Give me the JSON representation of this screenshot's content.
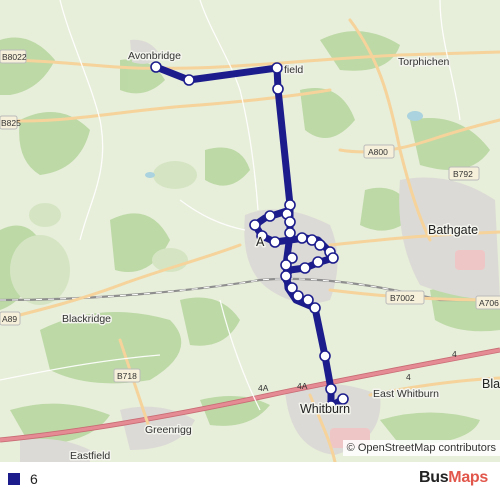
{
  "map": {
    "place_labels": [
      "Avonbridge",
      "field",
      "Torphichen",
      "Bathgate",
      "Blackridge",
      "Greenrigg",
      "Eastfield",
      "East Whitburn",
      "Whitburn",
      "Bla",
      "A"
    ],
    "road_labels": [
      "B8022",
      "B825",
      "A800",
      "B792",
      "B7002",
      "A706",
      "A89",
      "B718",
      "4A",
      "4A",
      "4",
      "4"
    ],
    "attribution_symbol": "©",
    "attribution_text": "OpenStreetMap contributors"
  },
  "legend": {
    "route_name": "6",
    "route_color": "#1c1c8c",
    "logo_part1": "Bus",
    "logo_part2": "Maps"
  },
  "colors": {
    "land": "#e7eed9",
    "woodland": "#b8d7a1",
    "urban": "#dcdad6",
    "motorway": "#e48b93",
    "major_road": "#f5d39b",
    "railway": "#8e8e8e",
    "route": "#1c1c8c"
  }
}
